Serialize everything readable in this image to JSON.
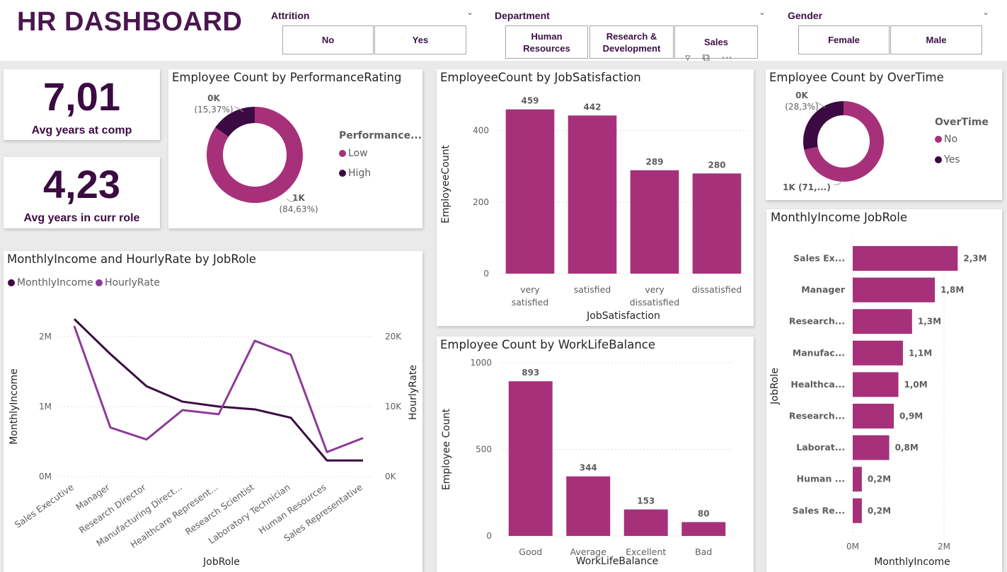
{
  "header": {
    "title": "HR DASHBOARD"
  },
  "slicers": {
    "attrition": {
      "title": "Attrition",
      "options": [
        "No",
        "Yes"
      ]
    },
    "department": {
      "title": "Department",
      "options": [
        "Human Resources",
        "Research & Development",
        "Sales"
      ]
    },
    "gender": {
      "title": "Gender",
      "options": [
        "Female",
        "Male"
      ]
    }
  },
  "kpis": [
    {
      "value": "7,01",
      "label": "Avg years at comp"
    },
    {
      "value": "4,23",
      "label": "Avg years in curr role"
    }
  ],
  "colors": {
    "primary": "#a6317a",
    "dark": "#3c0a42",
    "purple": "#8e3a9a",
    "title": "#4b1650"
  },
  "charts": {
    "perf": {
      "title": "Employee Count by PerformanceRating",
      "legend_title": "Performance...",
      "legend": [
        "Low",
        "High"
      ]
    },
    "jobsat": {
      "title": "EmployeeCount by JobSatisfaction"
    },
    "overtime": {
      "title": "Employee Count by OverTime",
      "legend_title": "OverTime",
      "legend": [
        "No",
        "Yes"
      ]
    },
    "income_role": {
      "title": "MonthlyIncome JobRole"
    },
    "combo": {
      "title": "MonthlyIncome and HourlyRate by JobRole",
      "legend": [
        "MonthlyIncome",
        "HourlyRate"
      ]
    },
    "wlb": {
      "title": "Employee Count by WorkLifeBalance"
    }
  },
  "chart_data": [
    {
      "id": "perf",
      "type": "pie",
      "title": "Employee Count by PerformanceRating",
      "labels": [
        "Low",
        "High"
      ],
      "values": [
        1244,
        226
      ],
      "data_labels": [
        [
          "1K",
          "(84,63%)"
        ],
        [
          "0K",
          "(15,37%)"
        ]
      ],
      "legend_title": "Performance..."
    },
    {
      "id": "jobsat",
      "type": "bar",
      "title": "EmployeeCount by JobSatisfaction",
      "categories": [
        "very satisfied",
        "satisfied",
        "very dissatisfied",
        "dissatisfied"
      ],
      "category_lines": [
        [
          "very",
          "satisfied"
        ],
        [
          "satisfied"
        ],
        [
          "very",
          "dissatisfied"
        ],
        [
          "dissatisfied"
        ]
      ],
      "values": [
        459,
        442,
        289,
        280
      ],
      "xlabel": "JobSatisfaction",
      "ylabel": "EmployeeCount",
      "ylim": [
        0,
        500
      ],
      "yticks": [
        "0",
        "200",
        "400"
      ],
      "ytick_values": [
        0,
        200,
        400
      ]
    },
    {
      "id": "overtime",
      "type": "pie",
      "title": "Employee Count by OverTime",
      "labels": [
        "No",
        "Yes"
      ],
      "values": [
        1054,
        416
      ],
      "data_labels": [
        [
          "1K (71,...)"
        ],
        [
          "0K",
          "(28,3%)"
        ]
      ],
      "legend_title": "OverTime"
    },
    {
      "id": "income_role",
      "type": "bar",
      "orientation": "horizontal",
      "title": "MonthlyIncome JobRole",
      "categories": [
        "Sales Ex...",
        "Manager",
        "Research...",
        "Manufac...",
        "Healthca...",
        "Research...",
        "Laborat...",
        "Human ...",
        "Sales Re..."
      ],
      "values": [
        2.3,
        1.8,
        1.3,
        1.1,
        1.0,
        0.9,
        0.8,
        0.2,
        0.2
      ],
      "value_labels": [
        "2,3M",
        "1,8M",
        "1,3M",
        "1,1M",
        "1,0M",
        "0,9M",
        "0,8M",
        "0,2M",
        "0,2M"
      ],
      "xlabel": "MonthlyIncome",
      "ylabel": "JobRole",
      "xlim": [
        0,
        2.6
      ],
      "xticks": [
        "0M",
        "2M"
      ],
      "xtick_values": [
        0,
        2
      ]
    },
    {
      "id": "combo",
      "type": "line",
      "title": "MonthlyIncome and HourlyRate by JobRole",
      "categories": [
        "Sales Executive",
        "Manager",
        "Research Director",
        "Manufacturing Direct...",
        "Healthcare Represent...",
        "Research Scientist",
        "Laboratory Technician",
        "Human Resources",
        "Sales Representative"
      ],
      "series": [
        {
          "name": "MonthlyIncome",
          "axis": "left",
          "values": [
            2.25,
            1.75,
            1.29,
            1.07,
            1.0,
            0.96,
            0.84,
            0.23,
            0.23
          ]
        },
        {
          "name": "HourlyRate",
          "axis": "right",
          "values": [
            21500,
            7000,
            5300,
            9500,
            8900,
            19400,
            17400,
            3500,
            5500
          ]
        }
      ],
      "xlabel": "JobRole",
      "ylabel": "MonthlyIncome",
      "y2label": "HourlyRate",
      "ylim": [
        0,
        2.0
      ],
      "yticks": [
        "0M",
        "1M",
        "2M"
      ],
      "ytick_values": [
        0,
        1,
        2
      ],
      "y2lim": [
        0,
        20000
      ],
      "y2ticks": [
        "0K",
        "10K",
        "20K"
      ],
      "y2tick_values": [
        0,
        10000,
        20000
      ]
    },
    {
      "id": "wlb",
      "type": "bar",
      "title": "Employee Count by WorkLifeBalance",
      "categories": [
        "Good",
        "Average",
        "Excellent",
        "Bad"
      ],
      "values": [
        893,
        344,
        153,
        80
      ],
      "xlabel": "WorkLifeBalance",
      "ylabel": "Employee Count",
      "ylim": [
        0,
        1000
      ],
      "yticks": [
        "0",
        "500",
        "1000"
      ],
      "ytick_values": [
        0,
        500,
        1000
      ]
    }
  ]
}
